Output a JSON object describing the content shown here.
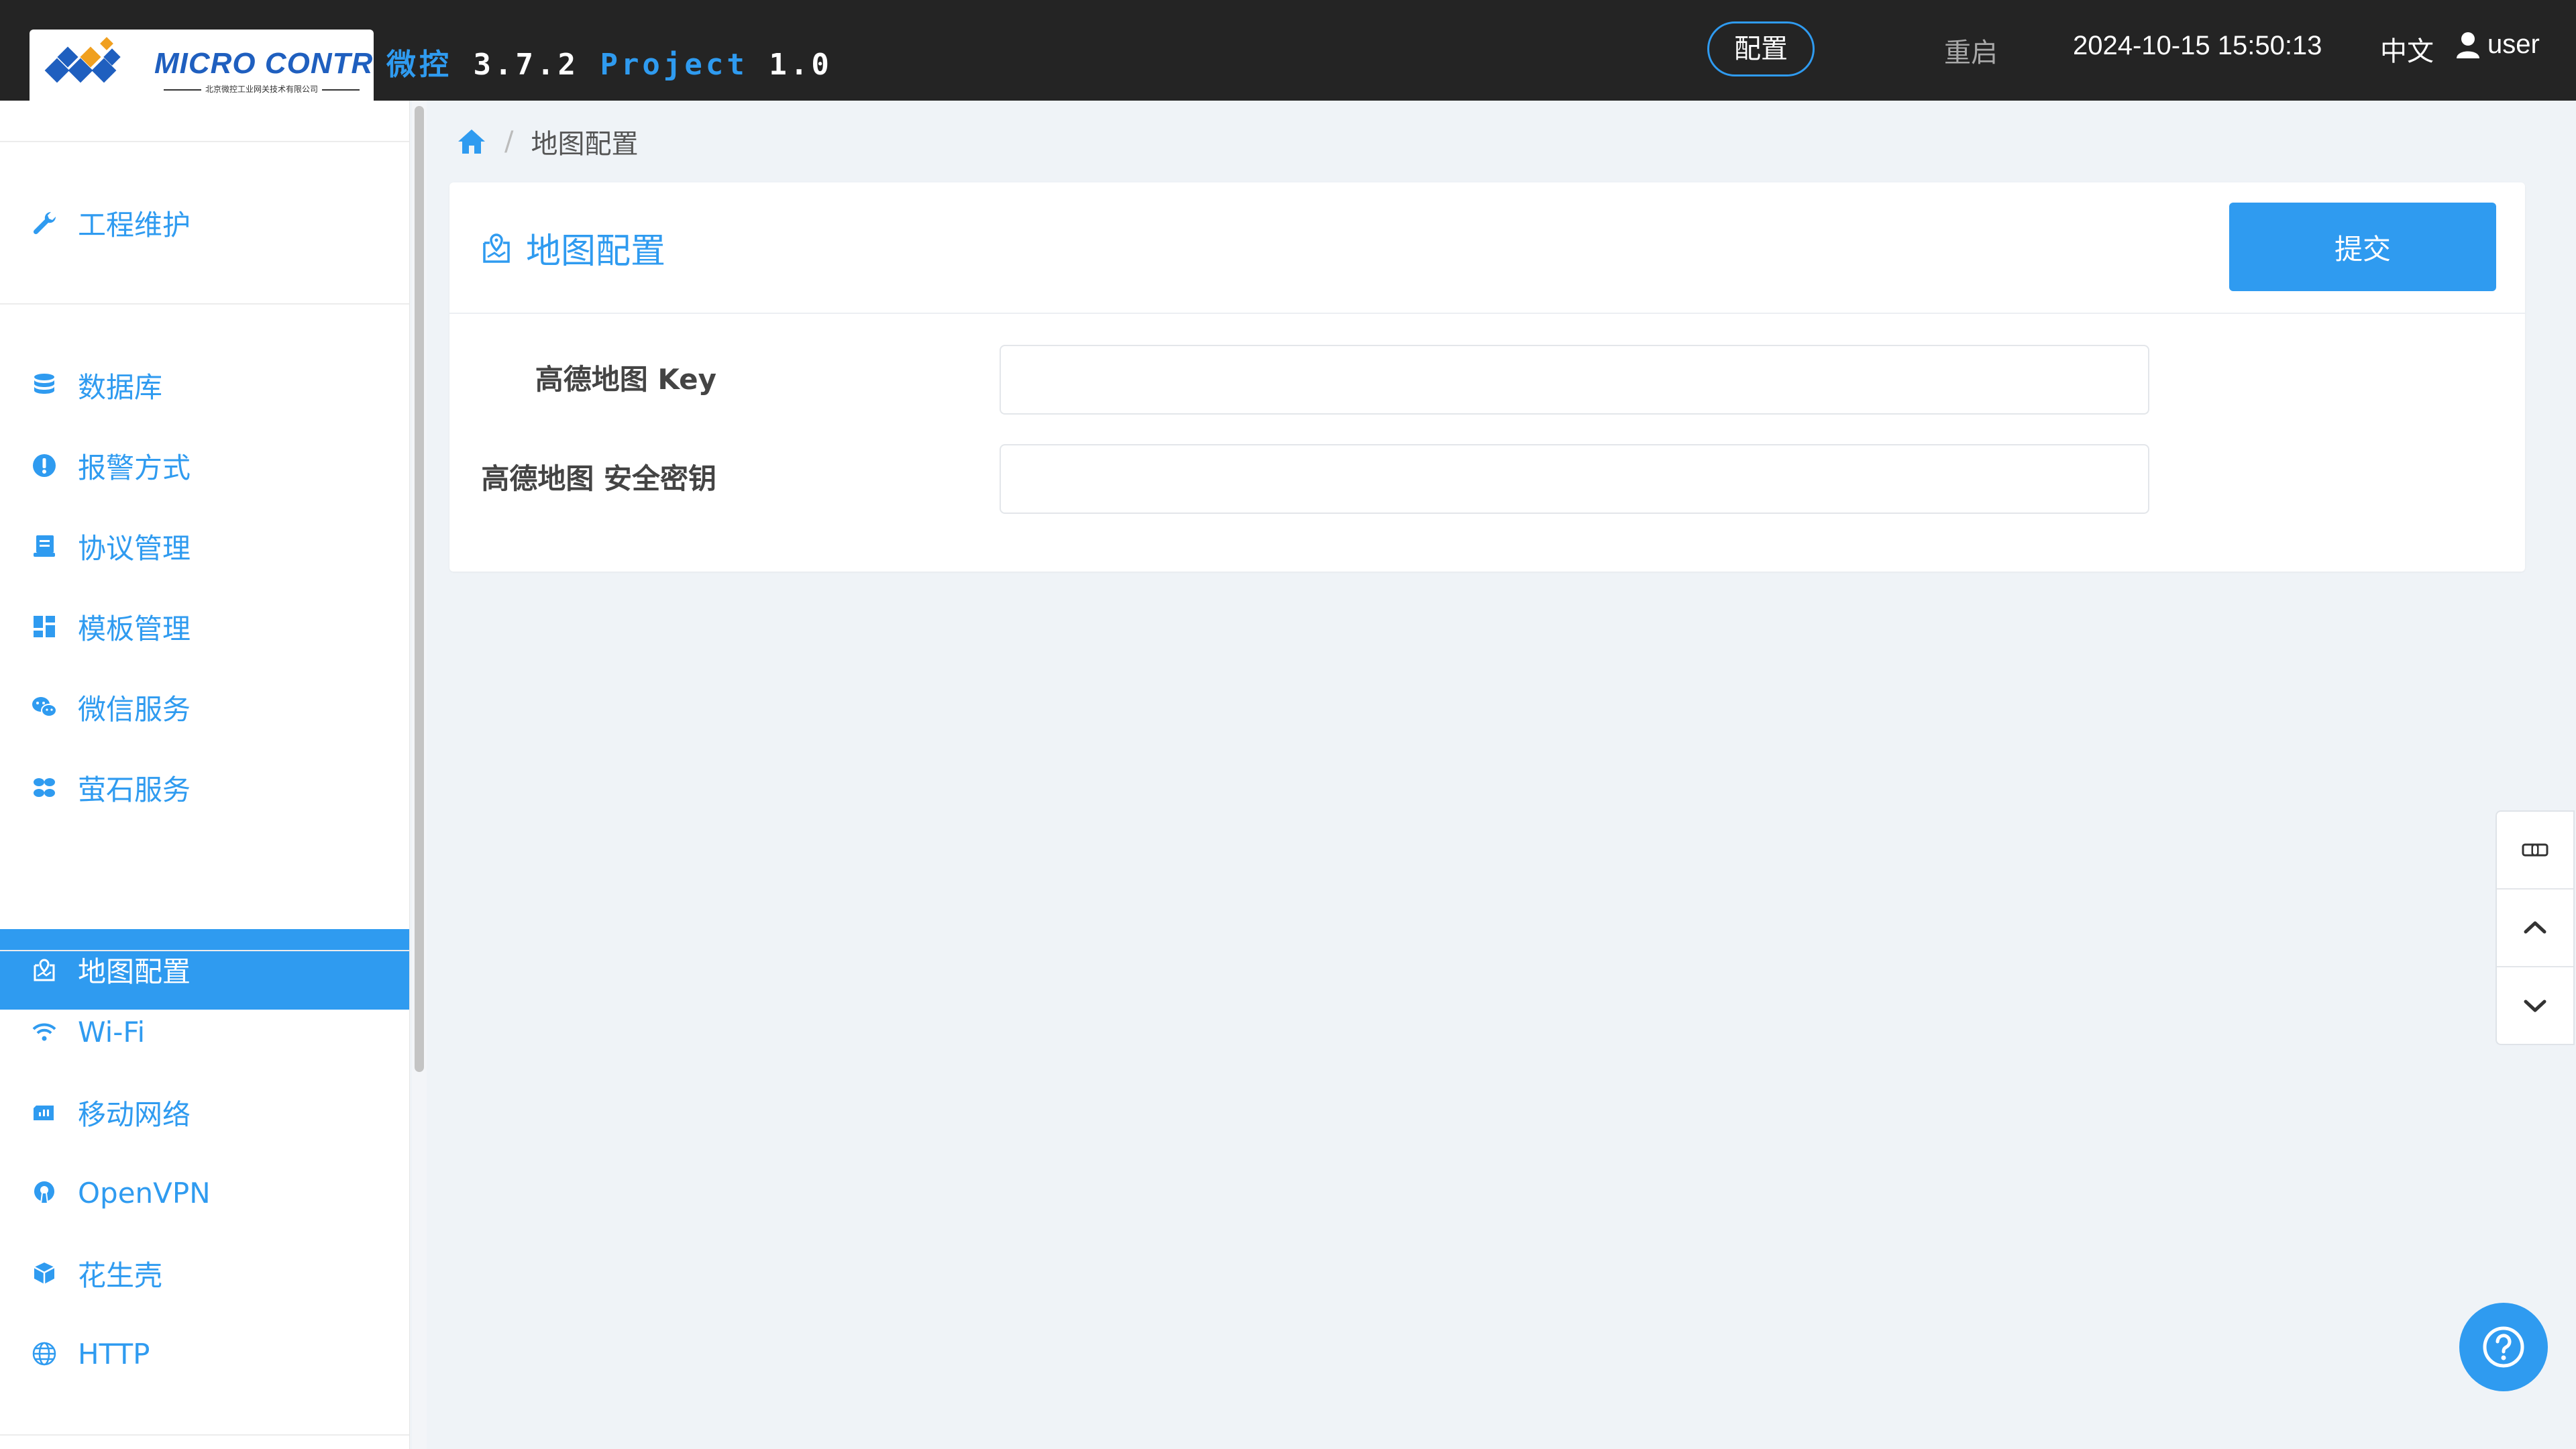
{
  "header": {
    "logo_text": "MICRO CONTROL",
    "logo_subtitle": "北京微控工业网关技术有限公司",
    "app_name": "微控",
    "app_version": "3.7.2",
    "project_label": "Project",
    "project_version": "1.0",
    "config_label": "配置",
    "restart_label": "重启",
    "datetime": "2024-10-15 15:50:13",
    "language": "中文",
    "username": "user"
  },
  "sidebar": {
    "items": [
      {
        "label": "工程维护",
        "icon": "wrench-icon"
      },
      {
        "label": "数据库",
        "icon": "database-icon"
      },
      {
        "label": "报警方式",
        "icon": "alert-icon"
      },
      {
        "label": "协议管理",
        "icon": "book-icon"
      },
      {
        "label": "模板管理",
        "icon": "dashboard-icon"
      },
      {
        "label": "微信服务",
        "icon": "wechat-icon"
      },
      {
        "label": "萤石服务",
        "icon": "fan-icon"
      },
      {
        "label": "地图配置",
        "icon": "map-config-icon",
        "active": true
      },
      {
        "label": "Wi-Fi",
        "icon": "wifi-icon"
      },
      {
        "label": "移动网络",
        "icon": "mobile-network-icon"
      },
      {
        "label": "OpenVPN",
        "icon": "openvpn-icon"
      },
      {
        "label": "花生壳",
        "icon": "cube-icon"
      },
      {
        "label": "HTTP",
        "icon": "globe-icon"
      }
    ]
  },
  "breadcrumb": {
    "current": "地图配置"
  },
  "panel": {
    "title": "地图配置",
    "submit_label": "提交",
    "fields": [
      {
        "label": "高德地图 Key",
        "value": "",
        "placeholder": ""
      },
      {
        "label": "高德地图 安全密钥",
        "value": "",
        "placeholder": ""
      }
    ]
  },
  "colors": {
    "accent": "#2f9bf0",
    "topbar": "#242424",
    "background": "#eff3f7"
  }
}
